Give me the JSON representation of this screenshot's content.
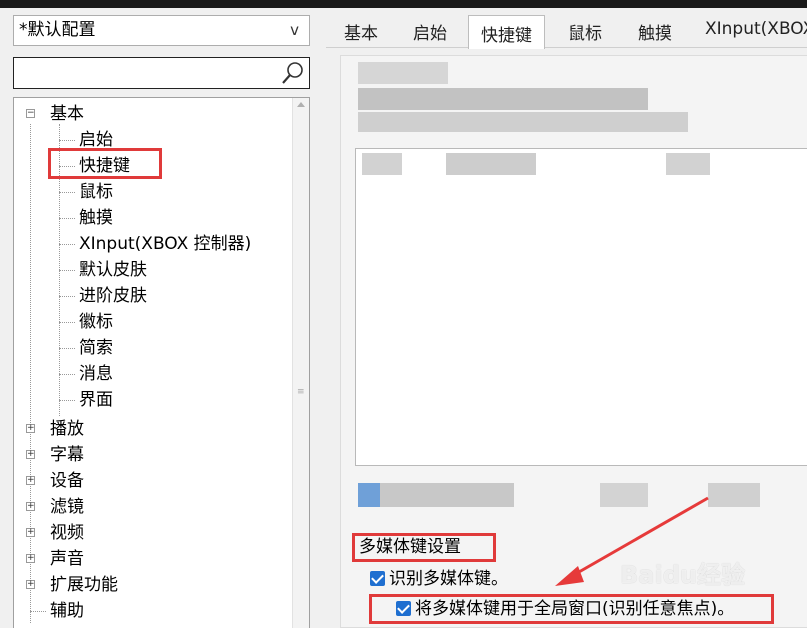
{
  "preset": {
    "value": "*默认配置",
    "caret": "v"
  },
  "tree": {
    "items": [
      {
        "label": "基本",
        "expander": "−"
      },
      {
        "label": "启始"
      },
      {
        "label": "快捷键"
      },
      {
        "label": "鼠标"
      },
      {
        "label": "触摸"
      },
      {
        "label": "XInput(XBOX 控制器)"
      },
      {
        "label": "默认皮肤"
      },
      {
        "label": "进阶皮肤"
      },
      {
        "label": "徽标"
      },
      {
        "label": "简索"
      },
      {
        "label": "消息"
      },
      {
        "label": "界面"
      },
      {
        "label": "播放",
        "expander": "+"
      },
      {
        "label": "字幕",
        "expander": "+"
      },
      {
        "label": "设备",
        "expander": "+"
      },
      {
        "label": "滤镜",
        "expander": "+"
      },
      {
        "label": "视频",
        "expander": "+"
      },
      {
        "label": "声音",
        "expander": "+"
      },
      {
        "label": "扩展功能",
        "expander": "+"
      },
      {
        "label": "辅助"
      }
    ]
  },
  "tabs": [
    "基本",
    "启始",
    "快捷键",
    "鼠标",
    "触摸",
    "XInput(XBOX"
  ],
  "active_tab": "快捷键",
  "multimedia": {
    "group_title": "多媒体键设置",
    "check1": "识别多媒体键。",
    "check2": "将多媒体键用于全局窗口(识别任意焦点)。"
  },
  "watermark": "Baidu经验",
  "colors": {
    "highlight": "#e03a3a",
    "checkbox": "#1f6fd0"
  }
}
